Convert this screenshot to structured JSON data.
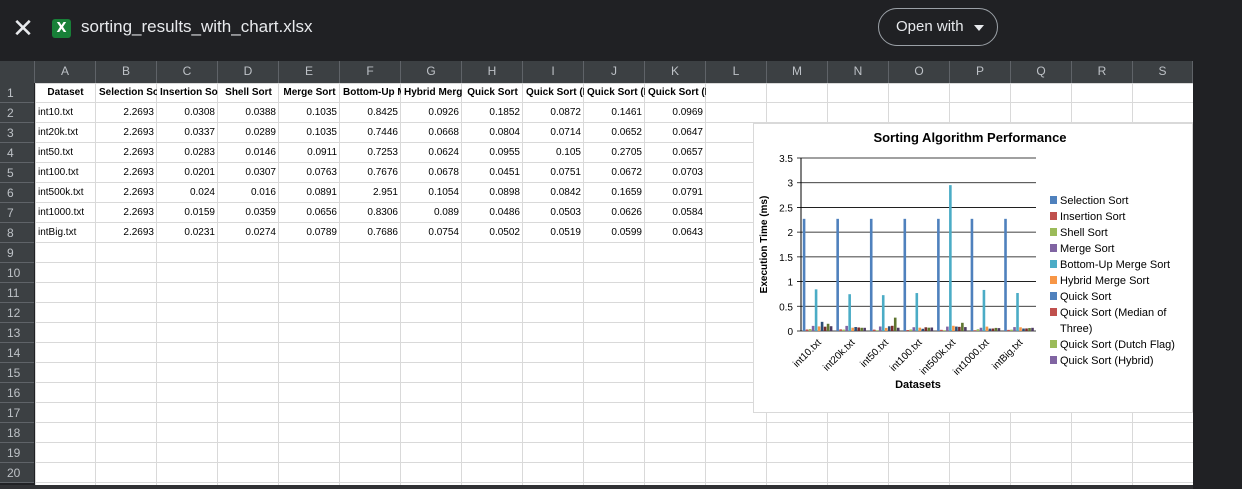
{
  "header": {
    "file_title": "sorting_results_with_chart.xlsx",
    "open_with_label": "Open with",
    "close_icon": "close-icon",
    "file_icon": "excel-file-icon",
    "file_icon_letter": "X"
  },
  "sheet": {
    "column_letters": [
      "A",
      "B",
      "C",
      "D",
      "E",
      "F",
      "G",
      "H",
      "I",
      "J",
      "K",
      "L",
      "M",
      "N",
      "O",
      "P",
      "Q",
      "R",
      "S"
    ],
    "row_numbers": [
      "1",
      "2",
      "3",
      "4",
      "5",
      "6",
      "7",
      "8",
      "9",
      "10",
      "11",
      "12",
      "13",
      "14",
      "15",
      "16",
      "17",
      "18",
      "19",
      "20"
    ],
    "table_headers": [
      "Dataset",
      "Selection Sort",
      "Insertion Sort",
      "Shell Sort",
      "Merge Sort",
      "Bottom-Up Merge Sort",
      "Hybrid Merge Sort",
      "Quick Sort",
      "Quick Sort (Median of Three)",
      "Quick Sort (Dutch Flag)",
      "Quick Sort (Hybrid)"
    ],
    "rows": [
      [
        "int10.txt",
        "2.2693",
        "0.0308",
        "0.0388",
        "0.1035",
        "0.8425",
        "0.0926",
        "0.1852",
        "0.0872",
        "0.1461",
        "0.0969"
      ],
      [
        "int20k.txt",
        "2.2693",
        "0.0337",
        "0.0289",
        "0.1035",
        "0.7446",
        "0.0668",
        "0.0804",
        "0.0714",
        "0.0652",
        "0.0647"
      ],
      [
        "int50.txt",
        "2.2693",
        "0.0283",
        "0.0146",
        "0.0911",
        "0.7253",
        "0.0624",
        "0.0955",
        "0.105",
        "0.2705",
        "0.0657"
      ],
      [
        "int100.txt",
        "2.2693",
        "0.0201",
        "0.0307",
        "0.0763",
        "0.7676",
        "0.0678",
        "0.0451",
        "0.0751",
        "0.0672",
        "0.0703"
      ],
      [
        "int500k.txt",
        "2.2693",
        "0.024",
        "0.016",
        "0.0891",
        "2.951",
        "0.1054",
        "0.0898",
        "0.0842",
        "0.1659",
        "0.0791"
      ],
      [
        "int1000.txt",
        "2.2693",
        "0.0159",
        "0.0359",
        "0.0656",
        "0.8306",
        "0.089",
        "0.0486",
        "0.0503",
        "0.0626",
        "0.0584"
      ],
      [
        "intBig.txt",
        "2.2693",
        "0.0231",
        "0.0274",
        "0.0789",
        "0.7686",
        "0.0754",
        "0.0502",
        "0.0519",
        "0.0599",
        "0.0643"
      ]
    ]
  },
  "chart_data": {
    "type": "bar",
    "title": "Sorting Algorithm Performance",
    "xlabel": "Datasets",
    "ylabel": "Execution Time (ms)",
    "ylim": [
      0,
      3.5
    ],
    "yticks": [
      "0",
      "0.5",
      "1",
      "1.5",
      "2",
      "2.5",
      "3",
      "3.5"
    ],
    "grid": true,
    "legend_position": "right",
    "categories": [
      "int10.txt",
      "int20k.txt",
      "int50.txt",
      "int100.txt",
      "int500k.txt",
      "int1000.txt",
      "intBig.txt"
    ],
    "series": [
      {
        "name": "Selection Sort",
        "color": "#4f81bd",
        "values": [
          2.2693,
          2.2693,
          2.2693,
          2.2693,
          2.2693,
          2.2693,
          2.2693
        ]
      },
      {
        "name": "Insertion Sort",
        "color": "#c0504d",
        "values": [
          0.0308,
          0.0337,
          0.0283,
          0.0201,
          0.024,
          0.0159,
          0.0231
        ]
      },
      {
        "name": "Shell Sort",
        "color": "#9bbb59",
        "values": [
          0.0388,
          0.0289,
          0.0146,
          0.0307,
          0.016,
          0.0359,
          0.0274
        ]
      },
      {
        "name": "Merge Sort",
        "color": "#8064a2",
        "values": [
          0.1035,
          0.1035,
          0.0911,
          0.0763,
          0.0891,
          0.0656,
          0.0789
        ]
      },
      {
        "name": "Bottom-Up Merge Sort",
        "color": "#4bacc6",
        "values": [
          0.8425,
          0.7446,
          0.7253,
          0.7676,
          2.951,
          0.8306,
          0.7686
        ]
      },
      {
        "name": "Hybrid Merge Sort",
        "color": "#f79646",
        "values": [
          0.0926,
          0.0668,
          0.0624,
          0.0678,
          0.1054,
          0.089,
          0.0754
        ]
      },
      {
        "name": "Quick Sort",
        "color": "#2c4d75",
        "values": [
          0.1852,
          0.0804,
          0.0955,
          0.0451,
          0.0898,
          0.0486,
          0.0502
        ]
      },
      {
        "name": "Quick Sort (Median of Three)",
        "color": "#772c2a",
        "values": [
          0.0872,
          0.0714,
          0.105,
          0.0751,
          0.0842,
          0.0503,
          0.0519
        ]
      },
      {
        "name": "Quick Sort (Dutch Flag)",
        "color": "#5f7530",
        "values": [
          0.1461,
          0.0652,
          0.2705,
          0.0672,
          0.1659,
          0.0626,
          0.0599
        ]
      },
      {
        "name": "Quick Sort (Hybrid)",
        "color": "#4d3b62",
        "values": [
          0.0969,
          0.0647,
          0.0657,
          0.0703,
          0.0791,
          0.0584,
          0.0643
        ]
      }
    ],
    "legend_colors": [
      "#4f81bd",
      "#c0504d",
      "#9bbb59",
      "#8064a2",
      "#4bacc6",
      "#f79646",
      "#4f81bd",
      "#c0504d",
      "#9bbb59",
      "#8064a2"
    ],
    "legend_lines": [
      [
        "Selection Sort"
      ],
      [
        "Insertion Sort"
      ],
      [
        "Shell Sort"
      ],
      [
        "Merge Sort"
      ],
      [
        "Bottom-Up Merge Sort"
      ],
      [
        "Hybrid Merge Sort"
      ],
      [
        "Quick Sort"
      ],
      [
        "Quick Sort (Median of",
        "Three)"
      ],
      [
        "Quick Sort (Dutch Flag)"
      ],
      [
        "Quick Sort (Hybrid)"
      ]
    ]
  }
}
